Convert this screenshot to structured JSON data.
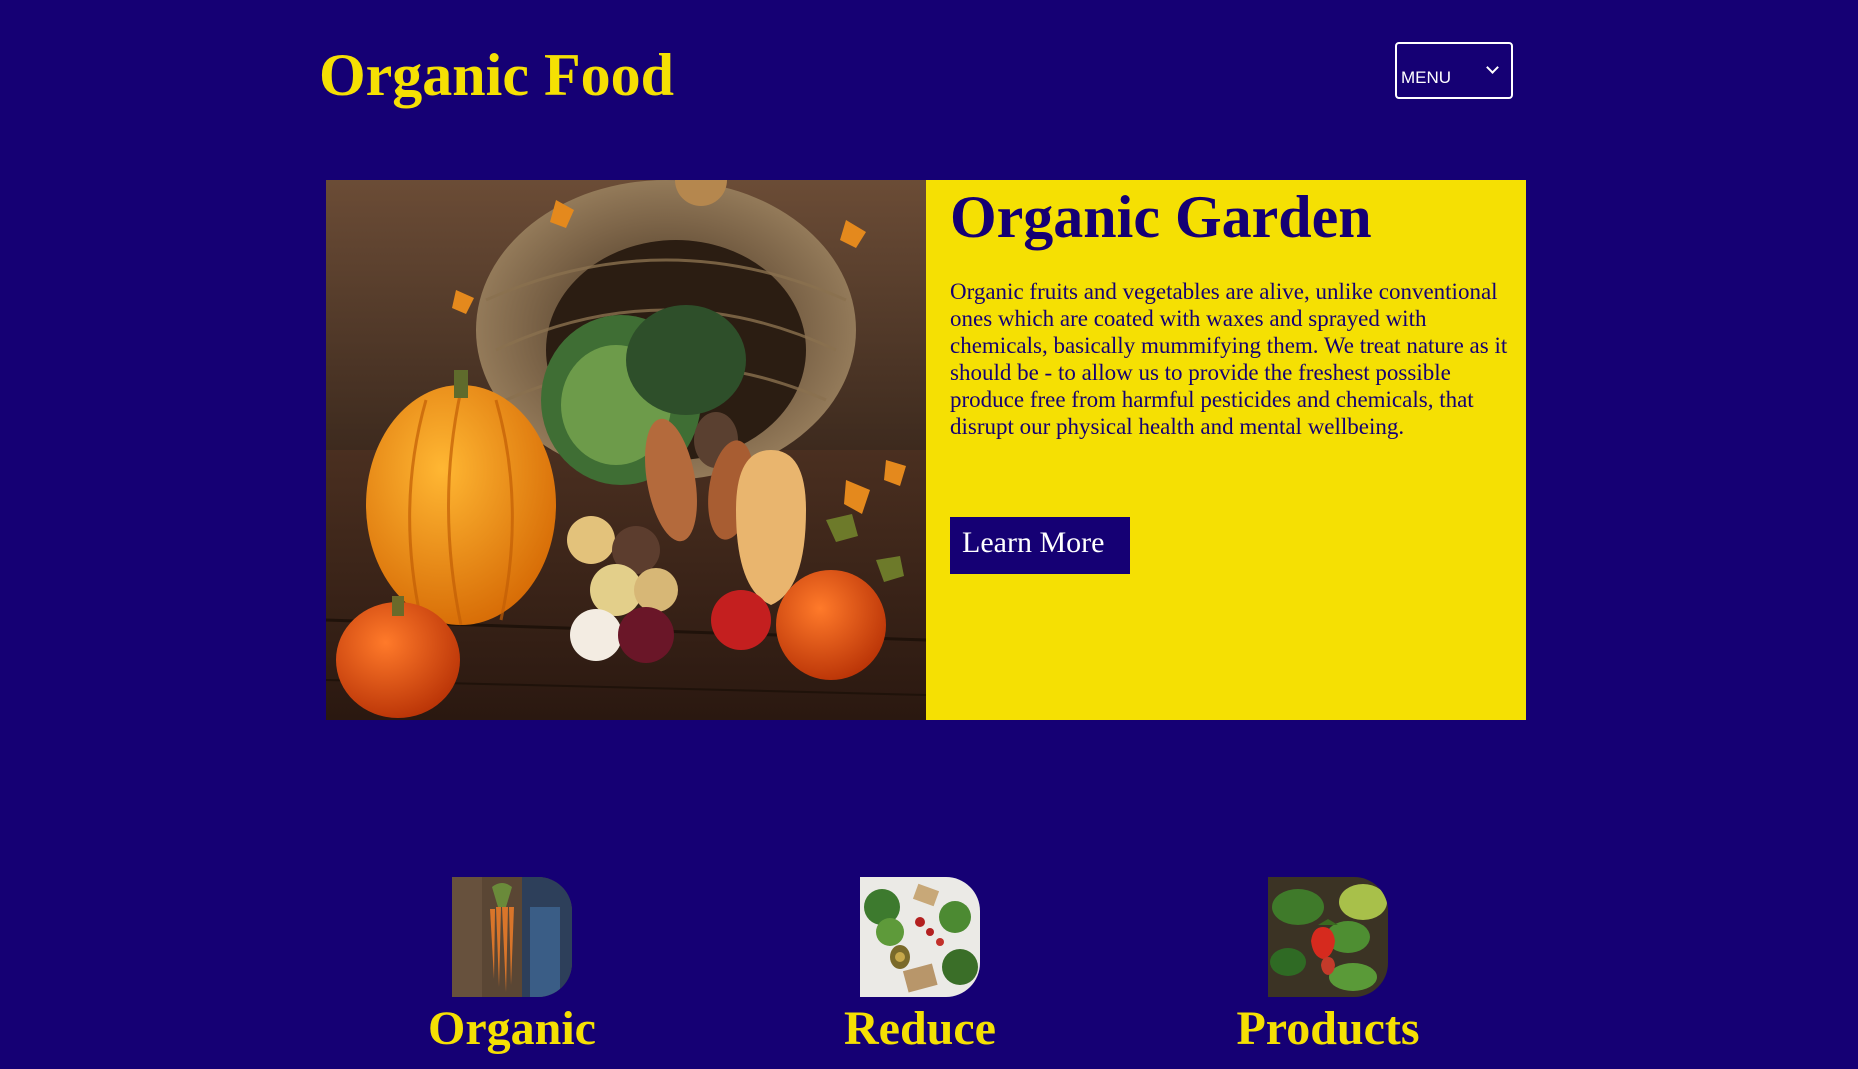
{
  "header": {
    "title": "Organic Food",
    "menu": {
      "selected": "MENU",
      "icon": "chevron-down-icon"
    }
  },
  "hero": {
    "title": "Organic Garden",
    "body": "Organic fruits and vegetables are alive, unlike conventional ones which are coated with waxes and sprayed with chemicals, basically mummifying them. We treat nature as it should be - to allow us to provide the freshest possible produce free from harmful pesticides and chemicals, that disrupt our physical health and mental wellbeing.",
    "button_label": "Learn More",
    "image": "harvest-basket-image"
  },
  "features": [
    {
      "label": "Organic",
      "image": "carrots-image"
    },
    {
      "label": "Reduce",
      "image": "vegetables-flatlay-image"
    },
    {
      "label": "Products",
      "image": "strawberry-plant-image"
    }
  ],
  "colors": {
    "background": "#150074",
    "accent": "#f5e003",
    "button_text": "#ffffff"
  }
}
